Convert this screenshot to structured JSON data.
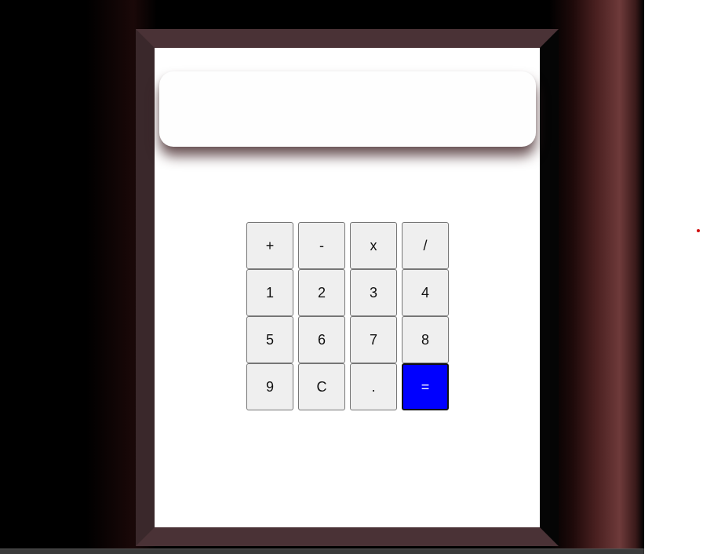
{
  "calculator": {
    "display_value": "",
    "keys": [
      {
        "label": "+",
        "name": "key-plus"
      },
      {
        "label": "-",
        "name": "key-minus"
      },
      {
        "label": "x",
        "name": "key-multiply"
      },
      {
        "label": "/",
        "name": "key-divide"
      },
      {
        "label": "1",
        "name": "key-1"
      },
      {
        "label": "2",
        "name": "key-2"
      },
      {
        "label": "3",
        "name": "key-3"
      },
      {
        "label": "4",
        "name": "key-4"
      },
      {
        "label": "5",
        "name": "key-5"
      },
      {
        "label": "6",
        "name": "key-6"
      },
      {
        "label": "7",
        "name": "key-7"
      },
      {
        "label": "8",
        "name": "key-8"
      },
      {
        "label": "9",
        "name": "key-9"
      },
      {
        "label": "C",
        "name": "key-clear"
      },
      {
        "label": ".",
        "name": "key-decimal"
      },
      {
        "label": "=",
        "name": "key-equals"
      }
    ]
  },
  "colors": {
    "frame": "#4a3236",
    "equals_key": "#0000ff",
    "key_background": "#efefef",
    "backdrop_accent": "#6e3a3a"
  }
}
